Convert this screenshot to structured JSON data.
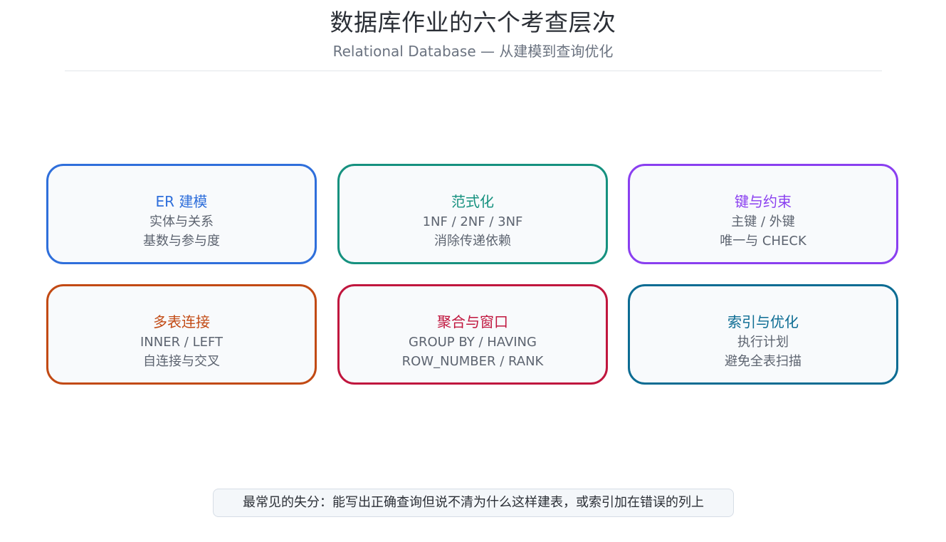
{
  "header": {
    "title": "数据库作业的六个考查层次",
    "subtitle": "Relational Database — 从建模到查询优化"
  },
  "cards": [
    {
      "title": "ER 建模",
      "line1": "实体与关系",
      "line2": "基数与参与度",
      "color": "#2f6fdb"
    },
    {
      "title": "范式化",
      "line1": "1NF / 2NF / 3NF",
      "line2": "消除传递依赖",
      "color": "#16917f"
    },
    {
      "title": "键与约束",
      "line1": "主键 / 外键",
      "line2": "唯一与 CHECK",
      "color": "#8a3ff0"
    },
    {
      "title": "多表连接",
      "line1": "INNER / LEFT",
      "line2": "自连接与交叉",
      "color": "#c24a14"
    },
    {
      "title": "聚合与窗口",
      "line1": "GROUP BY / HAVING",
      "line2": "ROW_NUMBER / RANK",
      "color": "#c0163e"
    },
    {
      "title": "索引与优化",
      "line1": "执行计划",
      "line2": "避免全表扫描",
      "color": "#0c6c93"
    }
  ],
  "footer": {
    "note": "最常见的失分：能写出正确查询但说不清为什么这样建表，或索引加在错误的列上"
  }
}
